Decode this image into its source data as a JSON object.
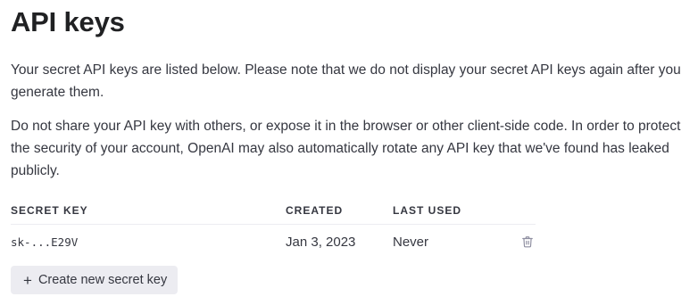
{
  "page": {
    "title": "API keys",
    "paragraphs": [
      "Your secret API keys are listed below. Please note that we do not display your secret API keys again after you generate them.",
      "Do not share your API key with others, or expose it in the browser or other client-side code. In order to protect the security of your account, OpenAI may also automatically rotate any API key that we've found has leaked publicly."
    ]
  },
  "table": {
    "headers": {
      "secret_key": "SECRET KEY",
      "created": "CREATED",
      "last_used": "LAST USED"
    },
    "rows": [
      {
        "secret_key": "sk-...E29V",
        "created": "Jan 3, 2023",
        "last_used": "Never",
        "action_icon": "trash-icon"
      }
    ]
  },
  "actions": {
    "create_plus": "+",
    "create_label": "Create new secret key"
  },
  "colors": {
    "text": "#353740",
    "title": "#202123",
    "button_bg": "#ececf1",
    "icon": "#8e8ea0"
  }
}
